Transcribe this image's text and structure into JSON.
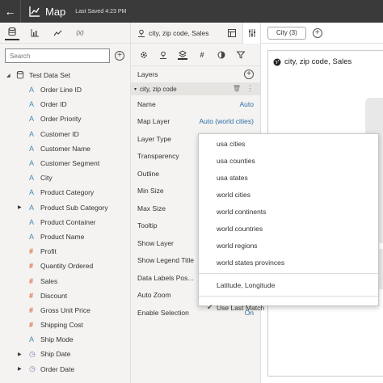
{
  "header": {
    "back_icon": "arrow-left-icon",
    "app_icon": "chart-icon",
    "title": "Map",
    "saved": "Last Saved 4:23 PM"
  },
  "left_panel": {
    "tabs": [
      {
        "name": "data-icon",
        "label": ""
      },
      {
        "name": "bar-chart-icon",
        "label": ""
      },
      {
        "name": "line-chart-icon",
        "label": ""
      },
      {
        "name": "formula-icon",
        "label": "(x)"
      }
    ],
    "search_placeholder": "Search",
    "root": "Test Data Set",
    "items": [
      {
        "icon": "A",
        "label": "Order Line ID",
        "expand": false
      },
      {
        "icon": "A",
        "label": "Order ID",
        "expand": false
      },
      {
        "icon": "A",
        "label": "Order Priority",
        "expand": false
      },
      {
        "icon": "A",
        "label": "Customer ID",
        "expand": false
      },
      {
        "icon": "A",
        "label": "Customer Name",
        "expand": false
      },
      {
        "icon": "A",
        "label": "Customer Segment",
        "expand": false
      },
      {
        "icon": "A",
        "label": "City",
        "expand": false
      },
      {
        "icon": "A",
        "label": "Product Category",
        "expand": false
      },
      {
        "icon": "A",
        "label": "Product Sub Category",
        "expand": true
      },
      {
        "icon": "A",
        "label": "Product Container",
        "expand": false
      },
      {
        "icon": "A",
        "label": "Product Name",
        "expand": false
      },
      {
        "icon": "#",
        "label": "Profit",
        "expand": false
      },
      {
        "icon": "#",
        "label": "Quantity Ordered",
        "expand": false
      },
      {
        "icon": "#",
        "label": "Sales",
        "expand": false
      },
      {
        "icon": "#",
        "label": "Discount",
        "expand": false
      },
      {
        "icon": "#",
        "label": "Gross Unit Price",
        "expand": false
      },
      {
        "icon": "#",
        "label": "Shipping Cost",
        "expand": false
      },
      {
        "icon": "A",
        "label": "Ship Mode",
        "expand": false
      },
      {
        "icon": "clock",
        "label": "Ship Date",
        "expand": true
      },
      {
        "icon": "clock",
        "label": "Order Date",
        "expand": true
      }
    ]
  },
  "mid_panel": {
    "header": "city, zip code, Sales",
    "layers_label": "Layers",
    "layer_name": "city, zip code",
    "props": [
      {
        "label": "Name",
        "value": "Auto"
      },
      {
        "label": "Map Layer",
        "value": "Auto (world cities)"
      },
      {
        "label": "Layer Type",
        "value": ""
      },
      {
        "label": "Transparency",
        "value": ""
      },
      {
        "label": "Outline",
        "value": ""
      },
      {
        "label": "Min Size",
        "value": ""
      },
      {
        "label": "Max Size",
        "value": ""
      },
      {
        "label": "Tooltip",
        "value": ""
      },
      {
        "label": "Show Layer",
        "value": ""
      },
      {
        "label": "Show Legend Title",
        "value": ""
      },
      {
        "label": "Data Labels Pos...",
        "value": ""
      },
      {
        "label": "Auto Zoom",
        "value": ""
      },
      {
        "label": "Enable Selection",
        "value": "On"
      }
    ]
  },
  "canvas": {
    "filter_pill": "City (3)",
    "viz_title": "city, zip code, Sales"
  },
  "dropdown": {
    "items": [
      "usa cities",
      "usa counties",
      "usa states",
      "world cities",
      "world continents",
      "world countries",
      "world regions",
      "world states provinces"
    ],
    "lat_long": "Latitude, Longitude",
    "last_match": "Use Last Match",
    "check": "✔"
  }
}
